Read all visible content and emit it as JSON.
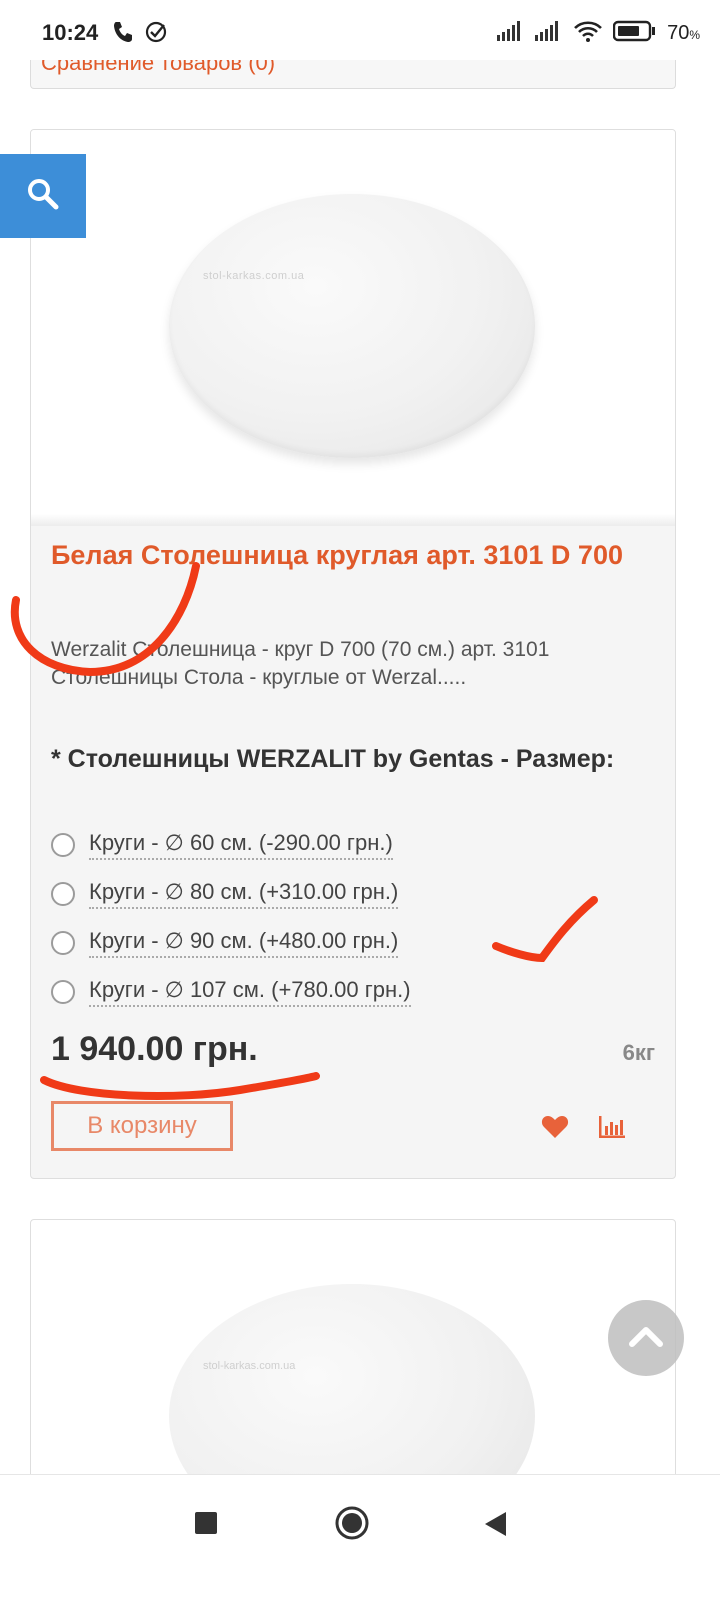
{
  "status_bar": {
    "time": "10:24",
    "battery_percent": "70",
    "battery_unit": "%",
    "icons_left": [
      "phone-icon",
      "check-circle-icon"
    ],
    "icons_right": [
      "signal-icon",
      "signal-icon",
      "wifi-icon",
      "battery-icon"
    ]
  },
  "compare": {
    "link_text": "Сравнение товаров (0)"
  },
  "product": {
    "title": "Белая Столешница круглая арт. 3101 D 700",
    "description": "Werzalit Столешница - круг D 700 (70 см.) арт. 3101 Столешницы Стола - круглые от Werzal.....",
    "watermark": "stol-karkas.com.ua",
    "option_heading": "* Столешницы WERZALIT by Gentas - Размер:",
    "options": [
      {
        "label": "Круги - ∅ 60 см. (-290.00 грн.)",
        "selected": false
      },
      {
        "label": "Круги - ∅ 80 см. (+310.00 грн.)",
        "selected": false
      },
      {
        "label": "Круги - ∅ 90 см. (+480.00 грн.)",
        "selected": false
      },
      {
        "label": "Круги - ∅ 107 см. (+780.00 грн.)",
        "selected": false
      }
    ],
    "price": "1 940.00 грн.",
    "weight": "6кг",
    "cart_button": "В корзину"
  },
  "next_product": {
    "watermark": "stol-karkas.com.ua"
  },
  "colors": {
    "accent": "#e05a2a",
    "search_tab": "#3d8ed8",
    "annotation": "#f03a17"
  },
  "icons": {
    "search": "search-icon",
    "wishlist": "heart-icon",
    "compare": "bar-chart-icon",
    "scroll_top": "chevron-up-icon",
    "nav_recents": "square-icon",
    "nav_home": "circle-icon",
    "nav_back": "triangle-back-icon"
  }
}
